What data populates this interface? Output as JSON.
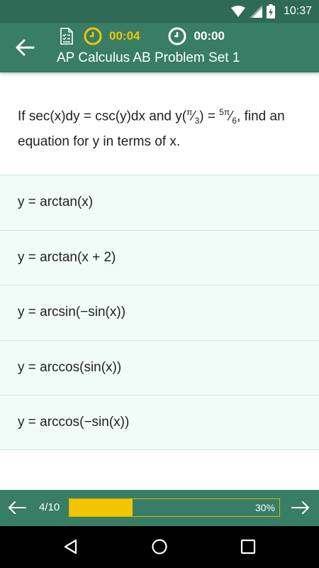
{
  "status_bar": {
    "time": "10:37",
    "icons": [
      "wifi-icon",
      "signal-icon",
      "battery-icon"
    ]
  },
  "app_bar": {
    "title": "AP Calculus AB Problem Set 1",
    "question_timer": "00:04",
    "total_timer": "00:00",
    "colors": {
      "bar": "#387d66",
      "status": "#2e6a55",
      "accent": "#f2c500"
    }
  },
  "question": {
    "text_before": "If sec(x)dy = csc(y)dx and y(",
    "pi_num": "π",
    "slash1": "⁄",
    "den3": "3",
    "mid": ") = ",
    "five_pi": "5π",
    "slash2": "⁄",
    "den6": "6",
    "text_after": ", find an equation for y in terms of x."
  },
  "answers": [
    {
      "label": "y = arctan(x)"
    },
    {
      "label": "y = arctan(x + 2)"
    },
    {
      "label": "y = arcsin(−sin(x))"
    },
    {
      "label": "y = arccos(sin(x))"
    },
    {
      "label": "y = arccos(−sin(x))"
    }
  ],
  "progress": {
    "counter": "4/10",
    "percent_label": "30%",
    "fraction": 0.3
  },
  "nav_bar": {
    "icons": [
      "back-triangle-icon",
      "home-circle-icon",
      "recents-square-icon"
    ]
  }
}
